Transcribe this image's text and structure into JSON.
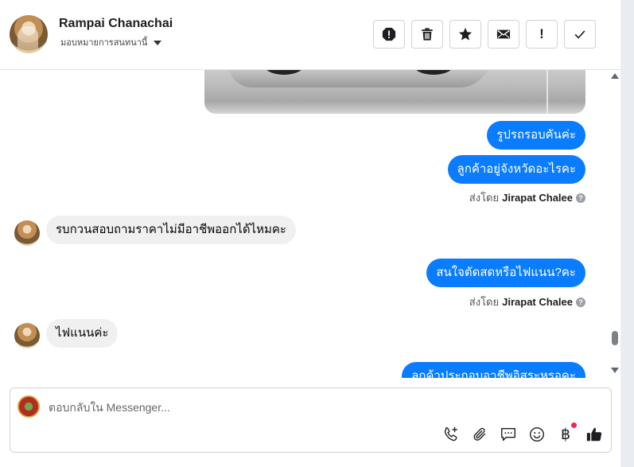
{
  "header": {
    "contact_name": "Rampai Chanachai",
    "assign_label": "มอบหมายการสนทนานี้",
    "actions": [
      {
        "name": "spam-icon",
        "label": ""
      },
      {
        "name": "trash-icon",
        "label": ""
      },
      {
        "name": "star-icon",
        "label": ""
      },
      {
        "name": "envelope-icon",
        "label": ""
      },
      {
        "name": "exclamation-icon",
        "label": "!"
      },
      {
        "name": "check-icon",
        "label": ""
      }
    ]
  },
  "messages": [
    {
      "direction": "outgoing",
      "text": "รูปรถรอบคันค่ะ"
    },
    {
      "direction": "outgoing",
      "text": "ลูกค้าอยู่จังหวัดอะไรคะ"
    },
    {
      "direction": "meta",
      "sent_by_label": "ส่งโดย",
      "agent": "Jirapat Chalee"
    },
    {
      "direction": "incoming",
      "text": "รบกวนสอบถามราคาไม่มีอาชีพออกได้ไหมคะ"
    },
    {
      "direction": "outgoing",
      "text": "สนใจตัดสดหรือไฟแนน?คะ"
    },
    {
      "direction": "meta",
      "sent_by_label": "ส่งโดย",
      "agent": "Jirapat Chalee"
    },
    {
      "direction": "incoming",
      "text": "ไฟแนนค่ะ"
    },
    {
      "direction": "outgoing",
      "text": "ลูกค้าประกอบอาชีพอิสระหรอคะ"
    }
  ],
  "composer": {
    "placeholder": "ตอบกลับใน Messenger...",
    "value": "",
    "tools": [
      "phone-add-icon",
      "paperclip-icon",
      "chat-bubble-icon",
      "smiley-icon",
      "baht-icon",
      "thumbs-up-icon"
    ],
    "baht_symbol": "฿"
  },
  "colors": {
    "outgoing_bubble": "#0a7cff",
    "incoming_bubble": "#f0f0f0",
    "notification_dot": "#f02849"
  }
}
